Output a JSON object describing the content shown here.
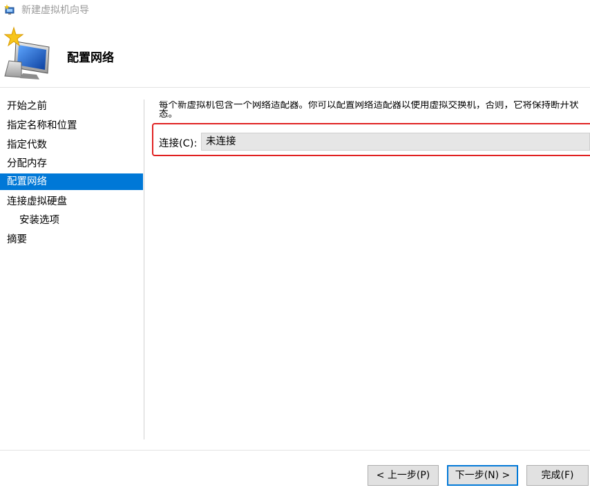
{
  "window": {
    "title": "新建虚拟机向导",
    "title_icon": "wizard-icon"
  },
  "header": {
    "title": "配置网络",
    "icon": "monitor-star-icon"
  },
  "sidebar": {
    "items": [
      {
        "label": "开始之前",
        "active": false,
        "sub": false
      },
      {
        "label": "指定名称和位置",
        "active": false,
        "sub": false
      },
      {
        "label": "指定代数",
        "active": false,
        "sub": false
      },
      {
        "label": "分配内存",
        "active": false,
        "sub": false
      },
      {
        "label": "配置网络",
        "active": true,
        "sub": false
      },
      {
        "label": "连接虚拟硬盘",
        "active": false,
        "sub": false
      },
      {
        "label": "安装选项",
        "active": false,
        "sub": true
      },
      {
        "label": "摘要",
        "active": false,
        "sub": false
      }
    ]
  },
  "main": {
    "description": "每个新虚拟机包含一个网络适配器。你可以配置网络适配器以使用虚拟交换机，否则，它将保持断开状态。",
    "connection_label": "连接(C):",
    "connection_value": "未连接",
    "highlight_color": "#e02020"
  },
  "footer": {
    "prev_label": "< 上一步(P)",
    "next_label": "下一步(N) >",
    "finish_label": "完成(F)"
  },
  "colors": {
    "accent": "#0078d7",
    "button_bg": "#e1e1e1"
  }
}
